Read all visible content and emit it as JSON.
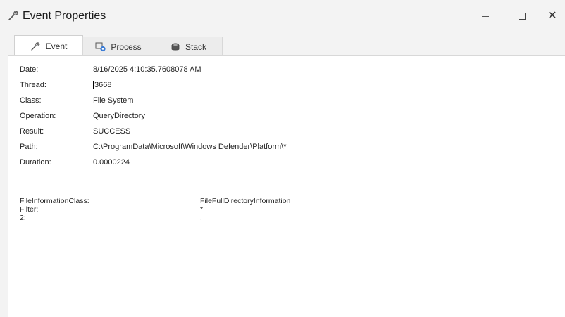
{
  "window": {
    "title": "Event Properties",
    "title_icon": "wrench-icon",
    "controls": {
      "minimize": "minimize-icon",
      "maximize": "maximize-icon",
      "close": "✕"
    }
  },
  "tabs": [
    {
      "label": "Event",
      "icon": "wrench-icon",
      "active": true
    },
    {
      "label": "Process",
      "icon": "process-gear-icon",
      "active": false
    },
    {
      "label": "Stack",
      "icon": "stack-icon",
      "active": false
    }
  ],
  "properties": [
    {
      "label": "Date:",
      "value": "8/16/2025 4:10:35.7608078 AM"
    },
    {
      "label": "Thread:",
      "value": "3668"
    },
    {
      "label": "Class:",
      "value": "File System"
    },
    {
      "label": "Operation:",
      "value": "QueryDirectory"
    },
    {
      "label": "Result:",
      "value": "SUCCESS"
    },
    {
      "label": "Path:",
      "value": "C:\\ProgramData\\Microsoft\\Windows Defender\\Platform\\*"
    },
    {
      "label": "Duration:",
      "value": "0.0000224"
    }
  ],
  "details": [
    {
      "label": "FileInformationClass:",
      "value": "FileFullDirectoryInformation"
    },
    {
      "label": "Filter:",
      "value": "*"
    },
    {
      "label": "2:",
      "value": "."
    }
  ],
  "colors": {
    "background": "#f3f3f3",
    "panel": "#ffffff",
    "border": "#d8d8d8"
  }
}
